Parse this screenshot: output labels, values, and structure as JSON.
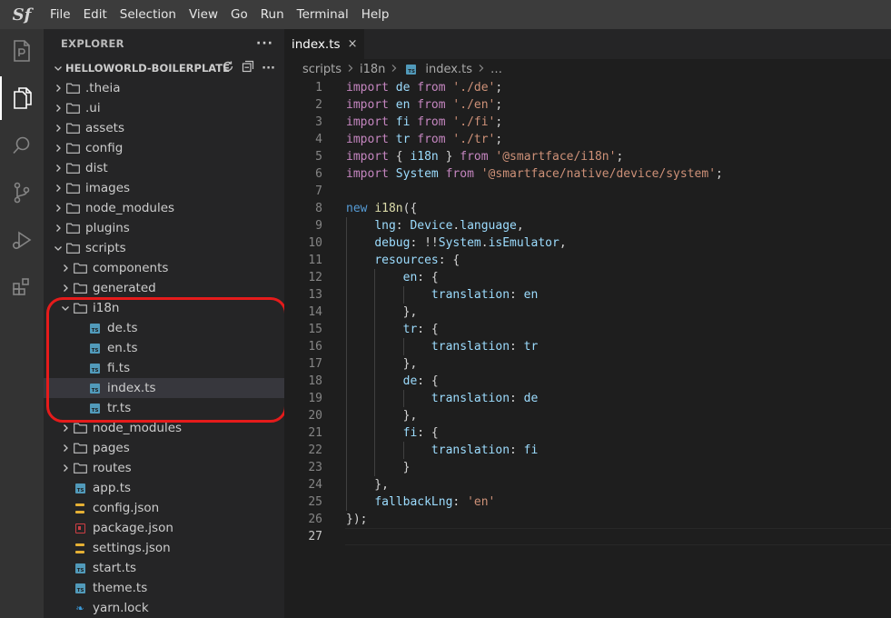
{
  "menubar": {
    "logo": "Sf",
    "items": [
      "File",
      "Edit",
      "Selection",
      "View",
      "Go",
      "Run",
      "Terminal",
      "Help"
    ]
  },
  "activity_bar": {
    "icons": [
      "project-icon",
      "explorer-icon",
      "search-icon",
      "source-control-icon",
      "run-debug-icon",
      "extensions-icon"
    ],
    "active": "explorer-icon"
  },
  "sidebar": {
    "title": "EXPLORER",
    "more": "···",
    "project": "HELLOWORLD-BOILERPLATE",
    "tree": [
      {
        "label": ".theia",
        "kind": "folder",
        "depth": 0,
        "open": false
      },
      {
        "label": ".ui",
        "kind": "folder",
        "depth": 0,
        "open": false
      },
      {
        "label": "assets",
        "kind": "folder",
        "depth": 0,
        "open": false
      },
      {
        "label": "config",
        "kind": "folder",
        "depth": 0,
        "open": false
      },
      {
        "label": "dist",
        "kind": "folder",
        "depth": 0,
        "open": false
      },
      {
        "label": "images",
        "kind": "folder",
        "depth": 0,
        "open": false
      },
      {
        "label": "node_modules",
        "kind": "folder",
        "depth": 0,
        "open": false
      },
      {
        "label": "plugins",
        "kind": "folder",
        "depth": 0,
        "open": false
      },
      {
        "label": "scripts",
        "kind": "folder",
        "depth": 0,
        "open": true
      },
      {
        "label": "components",
        "kind": "folder",
        "depth": 1,
        "open": false
      },
      {
        "label": "generated",
        "kind": "folder",
        "depth": 1,
        "open": false
      },
      {
        "label": "i18n",
        "kind": "folder",
        "depth": 1,
        "open": true
      },
      {
        "label": "de.ts",
        "kind": "ts",
        "depth": 2
      },
      {
        "label": "en.ts",
        "kind": "ts",
        "depth": 2
      },
      {
        "label": "fi.ts",
        "kind": "ts",
        "depth": 2
      },
      {
        "label": "index.ts",
        "kind": "ts",
        "depth": 2,
        "selected": true
      },
      {
        "label": "tr.ts",
        "kind": "ts",
        "depth": 2
      },
      {
        "label": "node_modules",
        "kind": "folder",
        "depth": 1,
        "open": false
      },
      {
        "label": "pages",
        "kind": "folder",
        "depth": 1,
        "open": false
      },
      {
        "label": "routes",
        "kind": "folder",
        "depth": 1,
        "open": false
      },
      {
        "label": "app.ts",
        "kind": "ts",
        "depth": 1
      },
      {
        "label": "config.json",
        "kind": "json",
        "depth": 1
      },
      {
        "label": "package.json",
        "kind": "pkg",
        "depth": 1
      },
      {
        "label": "settings.json",
        "kind": "json",
        "depth": 1
      },
      {
        "label": "start.ts",
        "kind": "ts",
        "depth": 1
      },
      {
        "label": "theme.ts",
        "kind": "ts",
        "depth": 1
      },
      {
        "label": "yarn.lock",
        "kind": "yarn",
        "depth": 1
      }
    ]
  },
  "editor": {
    "tab": {
      "label": "index.ts",
      "close": "×"
    },
    "breadcrumb": [
      "scripts",
      "i18n",
      "index.ts",
      "…"
    ],
    "current_line": 27,
    "lines": [
      [
        [
          "kwc",
          "import"
        ],
        [
          "pl",
          " "
        ],
        [
          "var",
          "de"
        ],
        [
          "pl",
          " "
        ],
        [
          "kwc",
          "from"
        ],
        [
          "pl",
          " "
        ],
        [
          "str",
          "'./de'"
        ],
        [
          "pl",
          ";"
        ]
      ],
      [
        [
          "kwc",
          "import"
        ],
        [
          "pl",
          " "
        ],
        [
          "var",
          "en"
        ],
        [
          "pl",
          " "
        ],
        [
          "kwc",
          "from"
        ],
        [
          "pl",
          " "
        ],
        [
          "str",
          "'./en'"
        ],
        [
          "pl",
          ";"
        ]
      ],
      [
        [
          "kwc",
          "import"
        ],
        [
          "pl",
          " "
        ],
        [
          "var",
          "fi"
        ],
        [
          "pl",
          " "
        ],
        [
          "kwc",
          "from"
        ],
        [
          "pl",
          " "
        ],
        [
          "str",
          "'./fi'"
        ],
        [
          "pl",
          ";"
        ]
      ],
      [
        [
          "kwc",
          "import"
        ],
        [
          "pl",
          " "
        ],
        [
          "var",
          "tr"
        ],
        [
          "pl",
          " "
        ],
        [
          "kwc",
          "from"
        ],
        [
          "pl",
          " "
        ],
        [
          "str",
          "'./tr'"
        ],
        [
          "pl",
          ";"
        ]
      ],
      [
        [
          "kwc",
          "import"
        ],
        [
          "pl",
          " { "
        ],
        [
          "var",
          "i18n"
        ],
        [
          "pl",
          " } "
        ],
        [
          "kwc",
          "from"
        ],
        [
          "pl",
          " "
        ],
        [
          "str",
          "'@smartface/i18n'"
        ],
        [
          "pl",
          ";"
        ]
      ],
      [
        [
          "kwc",
          "import"
        ],
        [
          "pl",
          " "
        ],
        [
          "var",
          "System"
        ],
        [
          "pl",
          " "
        ],
        [
          "kwc",
          "from"
        ],
        [
          "pl",
          " "
        ],
        [
          "str",
          "'@smartface/native/device/system'"
        ],
        [
          "pl",
          ";"
        ]
      ],
      [],
      [
        [
          "kw",
          "new"
        ],
        [
          "pl",
          " "
        ],
        [
          "fn",
          "i18n"
        ],
        [
          "pl",
          "({"
        ]
      ],
      [
        [
          "pl",
          "    "
        ],
        [
          "var",
          "lng"
        ],
        [
          "pl",
          ": "
        ],
        [
          "var",
          "Device"
        ],
        [
          "pl",
          "."
        ],
        [
          "var",
          "language"
        ],
        [
          "pl",
          ","
        ]
      ],
      [
        [
          "pl",
          "    "
        ],
        [
          "var",
          "debug"
        ],
        [
          "pl",
          ": !!"
        ],
        [
          "var",
          "System"
        ],
        [
          "pl",
          "."
        ],
        [
          "var",
          "isEmulator"
        ],
        [
          "pl",
          ","
        ]
      ],
      [
        [
          "pl",
          "    "
        ],
        [
          "var",
          "resources"
        ],
        [
          "pl",
          ": {"
        ]
      ],
      [
        [
          "pl",
          "        "
        ],
        [
          "var",
          "en"
        ],
        [
          "pl",
          ": {"
        ]
      ],
      [
        [
          "pl",
          "            "
        ],
        [
          "var",
          "translation"
        ],
        [
          "pl",
          ": "
        ],
        [
          "var",
          "en"
        ]
      ],
      [
        [
          "pl",
          "        },"
        ]
      ],
      [
        [
          "pl",
          "        "
        ],
        [
          "var",
          "tr"
        ],
        [
          "pl",
          ": {"
        ]
      ],
      [
        [
          "pl",
          "            "
        ],
        [
          "var",
          "translation"
        ],
        [
          "pl",
          ": "
        ],
        [
          "var",
          "tr"
        ]
      ],
      [
        [
          "pl",
          "        },"
        ]
      ],
      [
        [
          "pl",
          "        "
        ],
        [
          "var",
          "de"
        ],
        [
          "pl",
          ": {"
        ]
      ],
      [
        [
          "pl",
          "            "
        ],
        [
          "var",
          "translation"
        ],
        [
          "pl",
          ": "
        ],
        [
          "var",
          "de"
        ]
      ],
      [
        [
          "pl",
          "        },"
        ]
      ],
      [
        [
          "pl",
          "        "
        ],
        [
          "var",
          "fi"
        ],
        [
          "pl",
          ": {"
        ]
      ],
      [
        [
          "pl",
          "            "
        ],
        [
          "var",
          "translation"
        ],
        [
          "pl",
          ": "
        ],
        [
          "var",
          "fi"
        ]
      ],
      [
        [
          "pl",
          "        }"
        ]
      ],
      [
        [
          "pl",
          "    },"
        ]
      ],
      [
        [
          "pl",
          "    "
        ],
        [
          "var",
          "fallbackLng"
        ],
        [
          "pl",
          ": "
        ],
        [
          "str",
          "'en'"
        ]
      ],
      [
        [
          "pl",
          "});"
        ]
      ],
      []
    ]
  }
}
